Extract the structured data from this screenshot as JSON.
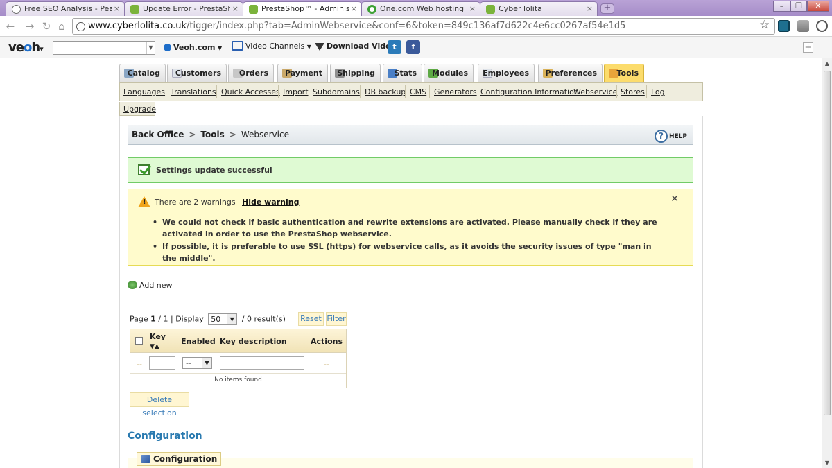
{
  "browser": {
    "tabs": [
      {
        "label": "Free SEO Analysis - Pear An",
        "icon": "globe-icon",
        "icon_color": "#6f6f6f"
      },
      {
        "label": "Update Error - PrestaShop F",
        "icon": "prestashop-icon",
        "icon_color": "#7bb33b"
      },
      {
        "label": "PrestaShop™ - Administrati",
        "icon": "prestashop-icon",
        "icon_color": "#7bb33b"
      },
      {
        "label": "One.com Web hosting - D",
        "icon": "onecom-icon",
        "icon_color": "#3ca033"
      },
      {
        "label": "Cyber lolita",
        "icon": "prestashop-icon",
        "icon_color": "#7bb33b"
      }
    ],
    "active_tab": 2,
    "tab_close_glyph": "×",
    "new_tab_glyph": "+",
    "window_buttons": {
      "minimize": "–",
      "restore": "❐",
      "close": "✕"
    },
    "url_host": "www.cyberlolita.co.uk",
    "url_path": "/tigger/index.php?tab=AdminWebservice&conf=6&token=849c136af7d622c4e6cc0267af54e1d5",
    "star_glyph": "☆"
  },
  "veoh_toolbar": {
    "logo_a": "ve",
    "logo_b": "o",
    "logo_c": "h",
    "logo_arrow": "▾",
    "search_value": "",
    "site_label": "Veoh.com",
    "channels_label": "Video Channels",
    "download_label": "Download Video",
    "twitter_glyph": "t",
    "facebook_glyph": "f",
    "add_glyph": "+"
  },
  "main_tabs": [
    {
      "label": "Catalog",
      "icon_color": "#8aa6c4"
    },
    {
      "label": "Customers",
      "icon_color": "#dfe4ea"
    },
    {
      "label": "Orders",
      "icon_color": "#c7c7c7"
    },
    {
      "label": "Payment",
      "icon_color": "#c9a86a"
    },
    {
      "label": "Shipping",
      "icon_color": "#8e8e8e"
    },
    {
      "label": "Stats",
      "icon_color": "#4a7fc6"
    },
    {
      "label": "Modules",
      "icon_color": "#5ea945"
    },
    {
      "label": "Employees",
      "icon_color": "#dfe4ea"
    },
    {
      "label": "Preferences",
      "icon_color": "#d9b25a"
    },
    {
      "label": "Tools",
      "icon_color": "#e8a43a"
    }
  ],
  "active_main_tab": "Tools",
  "sub_tabs": [
    "Languages",
    "Translations",
    "Quick Accesses",
    "Import",
    "Subdomains",
    "DB backup",
    "CMS",
    "Generators",
    "Configuration Information",
    "Webservice",
    "Stores",
    "Log"
  ],
  "upgrade_label": "Upgrade",
  "breadcrumb": {
    "items": [
      "Back Office",
      "Tools",
      "Webservice"
    ],
    "separator": ">",
    "help_label": "HELP",
    "help_glyph": "?"
  },
  "success_message": "Settings update successful",
  "warning": {
    "icon_glyph": "!",
    "count_text": "There are 2 warnings",
    "hide_label": "Hide warning",
    "close_glyph": "✕",
    "items": [
      "We could not check if basic authentication and rewrite extensions are activated. Please manually check if they are activated in order to use the PrestaShop webservice.",
      "If possible, it is preferable to use SSL (https) for webservice calls, as it avoids the security issues of type \"man in the middle\"."
    ]
  },
  "add_new_label": "Add new",
  "list": {
    "page_prefix": "Page",
    "page_current": "1",
    "page_total": "/ 1",
    "display_label": "| Display",
    "per_page": "50",
    "results_text": "/ 0 result(s)",
    "reset_label": "Reset",
    "filter_label": "Filter",
    "columns": [
      "Key",
      "Enabled",
      "Key description",
      "Actions"
    ],
    "sort_glyphs": "▼▲",
    "filter_dash": "--",
    "enabled_filter_value": "--",
    "dropdown_glyph": "▼",
    "empty_text": "No items found",
    "delete_selection_label": "Delete selection"
  },
  "configuration": {
    "title": "Configuration",
    "legend": "Configuration"
  }
}
